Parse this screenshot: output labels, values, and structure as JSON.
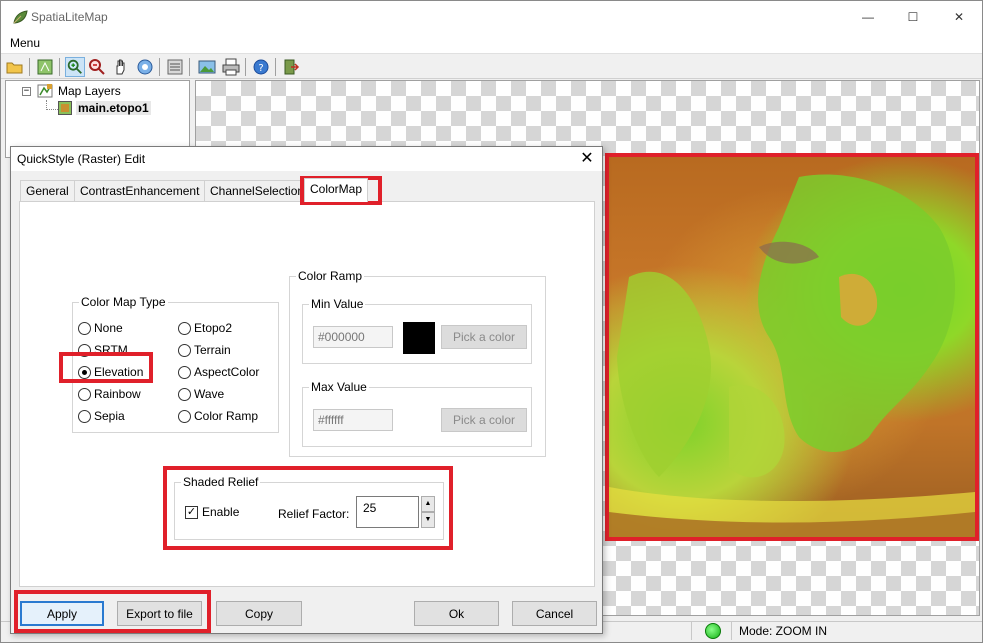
{
  "app": {
    "title": "SpatiaLiteMap",
    "menu": "Menu",
    "window_controls": {
      "minimize": "—",
      "maximize": "☐",
      "close": "✕"
    }
  },
  "layers": {
    "root_label": "Map Layers",
    "toggle": "−",
    "child_label": "main.etopo1"
  },
  "statusbar": {
    "mode": "Mode: ZOOM IN"
  },
  "dialog": {
    "title": "QuickStyle (Raster) Edit",
    "close": "✕",
    "tabs": [
      {
        "label": "General"
      },
      {
        "label": "ContrastEnhancement"
      },
      {
        "label": "ChannelSelection"
      },
      {
        "label": "ColorMap"
      }
    ],
    "active_tab": "ColorMap",
    "color_map_type": {
      "legend": "Color Map Type",
      "options": [
        "None",
        "SRTM",
        "Elevation",
        "Rainbow",
        "Sepia",
        "Etopo2",
        "Terrain",
        "AspectColor",
        "Wave",
        "Color Ramp"
      ],
      "selected": "Elevation"
    },
    "color_ramp": {
      "legend": "Color Ramp",
      "min": {
        "legend": "Min Value",
        "value": "#000000",
        "swatch": "#000000",
        "pick_label": "Pick a color"
      },
      "max": {
        "legend": "Max Value",
        "value": "#ffffff",
        "swatch": "#ffffff",
        "pick_label": "Pick a color"
      }
    },
    "shaded_relief": {
      "legend": "Shaded Relief",
      "enable_label": "Enable",
      "enabled": true,
      "factor_label": "Relief Factor:",
      "factor_value": "25"
    },
    "buttons": {
      "apply": "Apply",
      "export": "Export to file",
      "copy": "Copy",
      "ok": "Ok",
      "cancel": "Cancel"
    }
  },
  "colors": {
    "highlight": "#e0202a",
    "accent": "#2a7ad0"
  }
}
